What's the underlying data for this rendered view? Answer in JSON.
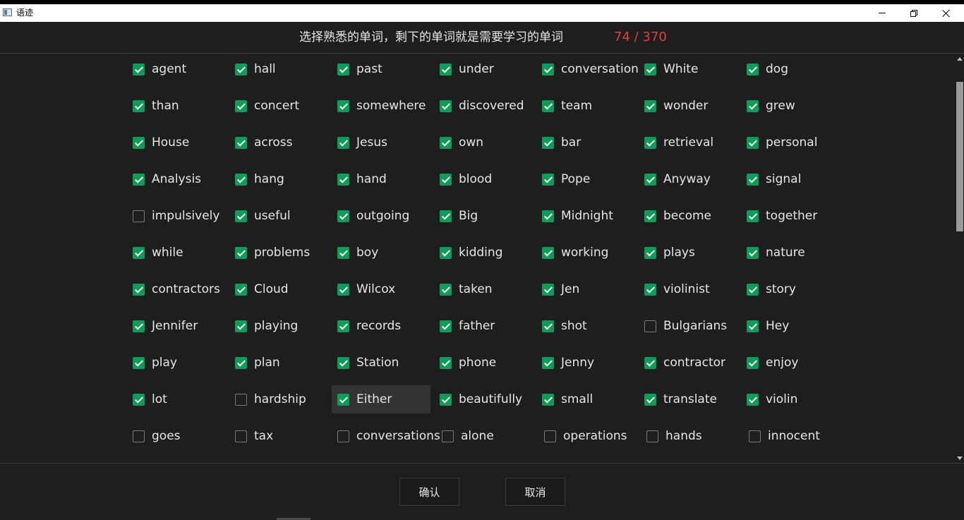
{
  "window": {
    "title": "语迹",
    "icon": "app-icon",
    "controls": [
      "minimize-icon",
      "restore-icon",
      "close-icon"
    ]
  },
  "header": {
    "prompt": "选择熟悉的单词，剩下的单词就是需要学习的单词",
    "counter": "74 / 370",
    "counter_color": "#e0413a"
  },
  "colors": {
    "background": "#1e1e1e",
    "checkbox_checked": "#0d9d58",
    "text": "#e6e6e6"
  },
  "words": [
    [
      {
        "w": "agent",
        "c": true
      },
      {
        "w": "hall",
        "c": true
      },
      {
        "w": "past",
        "c": true
      },
      {
        "w": "under",
        "c": true
      },
      {
        "w": "conversation",
        "c": true
      },
      {
        "w": "White",
        "c": true
      },
      {
        "w": "dog",
        "c": true
      }
    ],
    [
      {
        "w": "than",
        "c": true
      },
      {
        "w": "concert",
        "c": true
      },
      {
        "w": "somewhere",
        "c": true
      },
      {
        "w": "discovered",
        "c": true
      },
      {
        "w": "team",
        "c": true
      },
      {
        "w": "wonder",
        "c": true
      },
      {
        "w": "grew",
        "c": true
      }
    ],
    [
      {
        "w": "House",
        "c": true
      },
      {
        "w": "across",
        "c": true
      },
      {
        "w": "Jesus",
        "c": true
      },
      {
        "w": "own",
        "c": true
      },
      {
        "w": "bar",
        "c": true
      },
      {
        "w": "retrieval",
        "c": true
      },
      {
        "w": "personal",
        "c": true
      }
    ],
    [
      {
        "w": "Analysis",
        "c": true
      },
      {
        "w": "hang",
        "c": true
      },
      {
        "w": "hand",
        "c": true
      },
      {
        "w": "blood",
        "c": true
      },
      {
        "w": "Pope",
        "c": true
      },
      {
        "w": "Anyway",
        "c": true
      },
      {
        "w": "signal",
        "c": true
      }
    ],
    [
      {
        "w": "impulsively",
        "c": false
      },
      {
        "w": "useful",
        "c": true
      },
      {
        "w": "outgoing",
        "c": true
      },
      {
        "w": "Big",
        "c": true
      },
      {
        "w": "Midnight",
        "c": true
      },
      {
        "w": "become",
        "c": true
      },
      {
        "w": "together",
        "c": true
      }
    ],
    [
      {
        "w": "while",
        "c": true
      },
      {
        "w": "problems",
        "c": true
      },
      {
        "w": "boy",
        "c": true
      },
      {
        "w": "kidding",
        "c": true
      },
      {
        "w": "working",
        "c": true
      },
      {
        "w": "plays",
        "c": true
      },
      {
        "w": "nature",
        "c": true
      }
    ],
    [
      {
        "w": "contractors",
        "c": true
      },
      {
        "w": "Cloud",
        "c": true
      },
      {
        "w": "Wilcox",
        "c": true
      },
      {
        "w": "taken",
        "c": true
      },
      {
        "w": "Jen",
        "c": true
      },
      {
        "w": "violinist",
        "c": true
      },
      {
        "w": "story",
        "c": true
      }
    ],
    [
      {
        "w": "Jennifer",
        "c": true
      },
      {
        "w": "playing",
        "c": true
      },
      {
        "w": "records",
        "c": true
      },
      {
        "w": "father",
        "c": true
      },
      {
        "w": "shot",
        "c": true
      },
      {
        "w": "Bulgarians",
        "c": false
      },
      {
        "w": "Hey",
        "c": true
      }
    ],
    [
      {
        "w": "play",
        "c": true
      },
      {
        "w": "plan",
        "c": true
      },
      {
        "w": "Station",
        "c": true
      },
      {
        "w": "phone",
        "c": true
      },
      {
        "w": "Jenny",
        "c": true
      },
      {
        "w": "contractor",
        "c": true
      },
      {
        "w": "enjoy",
        "c": true
      }
    ],
    [
      {
        "w": "lot",
        "c": true
      },
      {
        "w": "hardship",
        "c": false
      },
      {
        "w": "Either",
        "c": true,
        "hover": true
      },
      {
        "w": "beautifully",
        "c": true
      },
      {
        "w": "small",
        "c": true
      },
      {
        "w": "translate",
        "c": true
      },
      {
        "w": "violin",
        "c": true
      }
    ],
    [
      {
        "w": "goes",
        "c": false
      },
      {
        "w": "tax",
        "c": false
      },
      {
        "w": "conversations",
        "c": false
      },
      {
        "w": "alone",
        "c": false
      },
      {
        "w": "operations",
        "c": false
      },
      {
        "w": "hands",
        "c": false
      },
      {
        "w": "innocent",
        "c": false
      }
    ]
  ],
  "buttons": {
    "confirm": "确认",
    "cancel": "取消"
  }
}
